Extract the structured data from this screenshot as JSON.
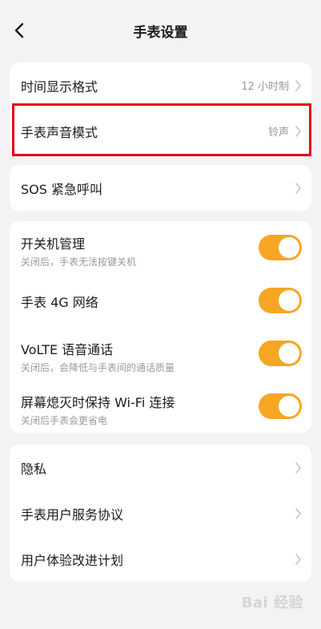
{
  "header": {
    "title": "手表设置"
  },
  "group1": {
    "items": [
      {
        "label": "时间显示格式",
        "value": "12 小时制"
      },
      {
        "label": "手表声音模式",
        "value": "铃声"
      }
    ]
  },
  "group2": {
    "items": [
      {
        "label": "SOS 紧急呼叫"
      }
    ]
  },
  "group3": {
    "items": [
      {
        "label": "开关机管理",
        "sub": "关闭后，手表无法按键关机",
        "on": true
      },
      {
        "label": "手表 4G 网络",
        "sub": "",
        "on": true
      },
      {
        "label": "VoLTE 语音通话",
        "sub": "关闭后，会降低与手表间的通话质量",
        "on": true
      },
      {
        "label": "屏幕熄灭时保持 Wi-Fi 连接",
        "sub": "关闭后手表会更省电",
        "on": true
      }
    ]
  },
  "group4": {
    "items": [
      {
        "label": "隐私"
      },
      {
        "label": "手表用户服务协议"
      },
      {
        "label": "用户体验改进计划"
      }
    ]
  },
  "watermark": "Bai 经验",
  "colors": {
    "accent": "#f6a623",
    "highlight": "#e60012",
    "background": "#f3f3f5"
  }
}
